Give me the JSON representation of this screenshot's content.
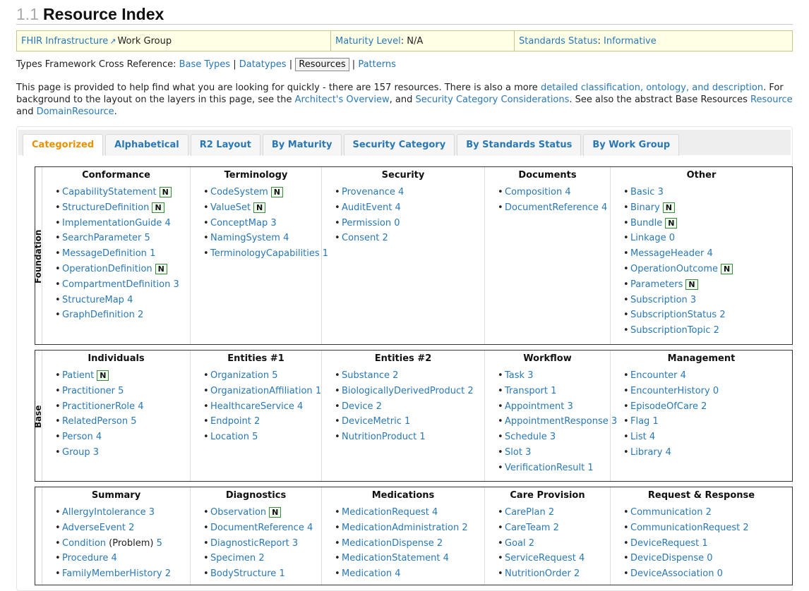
{
  "heading": {
    "number": "1.1",
    "title": "Resource Index"
  },
  "workgroup": {
    "link": "FHIR Infrastructure",
    "suffix": "Work Group",
    "maturity_label": "Maturity Level",
    "maturity_value": ": N/A",
    "status_label": "Standards Status",
    "status_value": "Informative"
  },
  "xref": {
    "prefix": "Types Framework Cross Reference:",
    "links": [
      "Base Types",
      "Datatypes",
      "Resources",
      "Patterns"
    ],
    "sep": "|"
  },
  "intro": {
    "t1": "This page is provided to help find what you are looking for quickly - there are 157 resources. There is also a more ",
    "l1": "detailed classification, ontology, and description",
    "t2": ". For background to the layout on the layers in this page, see the ",
    "l2": "Architect's Overview",
    "t3": ", and ",
    "l3": "Security Category Considerations",
    "t4": ". See also the abstract Base Resources ",
    "l4": "Resource",
    "t5": " and ",
    "l5": "DomainResource",
    "t6": "."
  },
  "tabs": [
    "Categorized",
    "Alphabetical",
    "R2 Layout",
    "By Maturity",
    "Security Category",
    "By Standards Status",
    "By Work Group"
  ],
  "badge": "N",
  "bands": [
    {
      "label": "Foundation",
      "columns": [
        {
          "title": "Conformance",
          "items": [
            {
              "name": "CapabilityStatement",
              "level": "",
              "n": true
            },
            {
              "name": "StructureDefinition",
              "level": "",
              "n": true
            },
            {
              "name": "ImplementationGuide",
              "level": "4"
            },
            {
              "name": "SearchParameter",
              "level": "5"
            },
            {
              "name": "MessageDefinition",
              "level": "1"
            },
            {
              "name": "OperationDefinition",
              "level": "",
              "n": true
            },
            {
              "name": "CompartmentDefinition",
              "level": "3"
            },
            {
              "name": "StructureMap",
              "level": "4"
            },
            {
              "name": "GraphDefinition",
              "level": "2"
            }
          ]
        },
        {
          "title": "Terminology",
          "items": [
            {
              "name": "CodeSystem",
              "level": "",
              "n": true
            },
            {
              "name": "ValueSet",
              "level": "",
              "n": true
            },
            {
              "name": "ConceptMap",
              "level": "3"
            },
            {
              "name": "NamingSystem",
              "level": "4"
            },
            {
              "name": "TerminologyCapabilities",
              "level": "1"
            }
          ]
        },
        {
          "title": "Security",
          "items": [
            {
              "name": "Provenance",
              "level": "4"
            },
            {
              "name": "AuditEvent",
              "level": "4"
            },
            {
              "name": "Permission",
              "level": "0"
            },
            {
              "name": "Consent",
              "level": "2"
            }
          ]
        },
        {
          "title": "Documents",
          "items": [
            {
              "name": "Composition",
              "level": "4"
            },
            {
              "name": "DocumentReference",
              "level": "4"
            }
          ]
        },
        {
          "title": "Other",
          "items": [
            {
              "name": "Basic",
              "level": "3"
            },
            {
              "name": "Binary",
              "level": "",
              "n": true
            },
            {
              "name": "Bundle",
              "level": "",
              "n": true
            },
            {
              "name": "Linkage",
              "level": "0"
            },
            {
              "name": "MessageHeader",
              "level": "4"
            },
            {
              "name": "OperationOutcome",
              "level": "",
              "n": true
            },
            {
              "name": "Parameters",
              "level": "",
              "n": true
            },
            {
              "name": "Subscription",
              "level": "3"
            },
            {
              "name": "SubscriptionStatus",
              "level": "2"
            },
            {
              "name": "SubscriptionTopic",
              "level": "2"
            }
          ]
        }
      ]
    },
    {
      "label": "Base",
      "columns": [
        {
          "title": "Individuals",
          "items": [
            {
              "name": "Patient",
              "level": "",
              "n": true
            },
            {
              "name": "Practitioner",
              "level": "5"
            },
            {
              "name": "PractitionerRole",
              "level": "4"
            },
            {
              "name": "RelatedPerson",
              "level": "5"
            },
            {
              "name": "Person",
              "level": "4"
            },
            {
              "name": "Group",
              "level": "3"
            }
          ]
        },
        {
          "title": "Entities #1",
          "items": [
            {
              "name": "Organization",
              "level": "5"
            },
            {
              "name": "OrganizationAffiliation",
              "level": "1"
            },
            {
              "name": "HealthcareService",
              "level": "4"
            },
            {
              "name": "Endpoint",
              "level": "2"
            },
            {
              "name": "Location",
              "level": "5"
            }
          ]
        },
        {
          "title": "Entities #2",
          "items": [
            {
              "name": "Substance",
              "level": "2"
            },
            {
              "name": "BiologicallyDerivedProduct",
              "level": "2"
            },
            {
              "name": "Device",
              "level": "2"
            },
            {
              "name": "DeviceMetric",
              "level": "1"
            },
            {
              "name": "NutritionProduct",
              "level": "1"
            }
          ]
        },
        {
          "title": "Workflow",
          "items": [
            {
              "name": "Task",
              "level": "3"
            },
            {
              "name": "Transport",
              "level": "1"
            },
            {
              "name": "Appointment",
              "level": "3"
            },
            {
              "name": "AppointmentResponse",
              "level": "3"
            },
            {
              "name": "Schedule",
              "level": "3"
            },
            {
              "name": "Slot",
              "level": "3"
            },
            {
              "name": "VerificationResult",
              "level": "1"
            }
          ]
        },
        {
          "title": "Management",
          "items": [
            {
              "name": "Encounter",
              "level": "4"
            },
            {
              "name": "EncounterHistory",
              "level": "0"
            },
            {
              "name": "EpisodeOfCare",
              "level": "2"
            },
            {
              "name": "Flag",
              "level": "1"
            },
            {
              "name": "List",
              "level": "4"
            },
            {
              "name": "Library",
              "level": "4"
            }
          ]
        }
      ]
    },
    {
      "label": "",
      "columns": [
        {
          "title": "Summary",
          "items": [
            {
              "name": "AllergyIntolerance",
              "level": "3"
            },
            {
              "name": "AdverseEvent",
              "level": "2"
            },
            {
              "name": "Condition",
              "level": "5",
              "note": " (Problem) "
            },
            {
              "name": "Procedure",
              "level": "4"
            },
            {
              "name": "FamilyMemberHistory",
              "level": "2"
            }
          ]
        },
        {
          "title": "Diagnostics",
          "items": [
            {
              "name": "Observation",
              "level": "",
              "n": true
            },
            {
              "name": "DocumentReference",
              "level": "4"
            },
            {
              "name": "DiagnosticReport",
              "level": "3"
            },
            {
              "name": "Specimen",
              "level": "2"
            },
            {
              "name": "BodyStructure",
              "level": "1"
            }
          ]
        },
        {
          "title": "Medications",
          "items": [
            {
              "name": "MedicationRequest",
              "level": "4"
            },
            {
              "name": "MedicationAdministration",
              "level": "2"
            },
            {
              "name": "MedicationDispense",
              "level": "2"
            },
            {
              "name": "MedicationStatement",
              "level": "4"
            },
            {
              "name": "Medication",
              "level": "4"
            }
          ]
        },
        {
          "title": "Care Provision",
          "items": [
            {
              "name": "CarePlan",
              "level": "2"
            },
            {
              "name": "CareTeam",
              "level": "2"
            },
            {
              "name": "Goal",
              "level": "2"
            },
            {
              "name": "ServiceRequest",
              "level": "4"
            },
            {
              "name": "NutritionOrder",
              "level": "2"
            }
          ]
        },
        {
          "title": "Request & Response",
          "items": [
            {
              "name": "Communication",
              "level": "2"
            },
            {
              "name": "CommunicationRequest",
              "level": "2"
            },
            {
              "name": "DeviceRequest",
              "level": "1"
            },
            {
              "name": "DeviceDispense",
              "level": "0"
            },
            {
              "name": "DeviceAssociation",
              "level": "0"
            }
          ]
        }
      ]
    }
  ]
}
